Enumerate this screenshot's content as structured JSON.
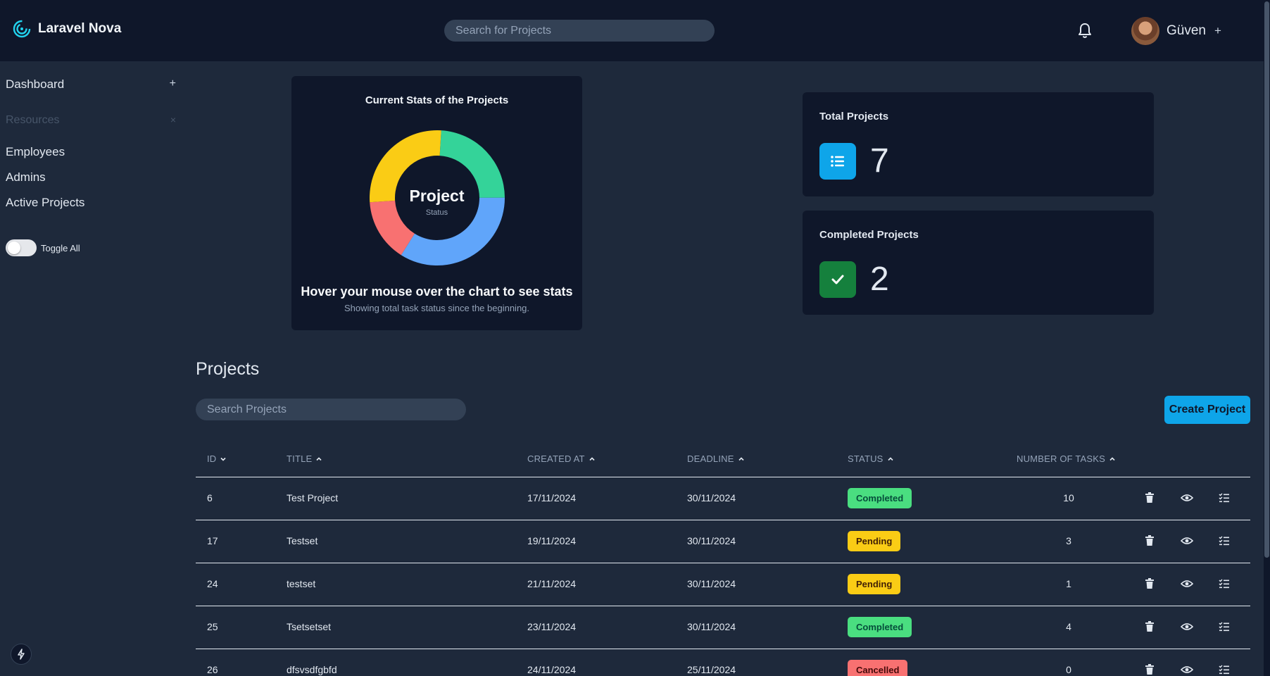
{
  "header": {
    "brand": "Laravel Nova",
    "search_placeholder": "Search for Projects",
    "user_name": "Güven",
    "user_plus": "+"
  },
  "sidebar": {
    "dashboard": "Dashboard",
    "dashboard_plus": "+",
    "resources": "Resources",
    "resources_close": "×",
    "items": [
      {
        "label": "Employees"
      },
      {
        "label": "Admins"
      },
      {
        "label": "Active Projects"
      }
    ],
    "toggle_label": "Toggle All"
  },
  "chart_card": {
    "title": "Current Stats of the Projects",
    "center_title": "Project",
    "center_sub": "Status",
    "hover_text": "Hover your mouse over the chart to see stats",
    "description": "Showing total task status since the beginning."
  },
  "chart_data": {
    "type": "pie",
    "title": "Current Stats of the Projects",
    "series": [
      {
        "value": 0.24,
        "color": "#34d399"
      },
      {
        "value": 0.34,
        "color": "#60a5fa"
      },
      {
        "value": 0.15,
        "color": "#f87171"
      },
      {
        "value": 0.27,
        "color": "#facc15"
      }
    ]
  },
  "metrics": {
    "total_label": "Total Projects",
    "total_value": "7",
    "completed_label": "Completed Projects",
    "completed_value": "2"
  },
  "projects": {
    "title": "Projects",
    "search_placeholder": "Search Projects",
    "create_label": "Create Project",
    "columns": [
      "ID",
      "TITLE",
      "CREATED AT",
      "DEADLINE",
      "STATUS",
      "NUMBER OF TASKS"
    ],
    "rows": [
      {
        "id": "6",
        "title": "Test Project",
        "created": "17/11/2024",
        "deadline": "30/11/2024",
        "status": "Completed",
        "tasks": "10"
      },
      {
        "id": "17",
        "title": "Testset",
        "created": "19/11/2024",
        "deadline": "30/11/2024",
        "status": "Pending",
        "tasks": "3"
      },
      {
        "id": "24",
        "title": "testset",
        "created": "21/11/2024",
        "deadline": "30/11/2024",
        "status": "Pending",
        "tasks": "1"
      },
      {
        "id": "25",
        "title": "Tsetsetset",
        "created": "23/11/2024",
        "deadline": "30/11/2024",
        "status": "Completed",
        "tasks": "4"
      },
      {
        "id": "26",
        "title": "dfsvsdfgbfd",
        "created": "24/11/2024",
        "deadline": "25/11/2024",
        "status": "Cancelled",
        "tasks": "0"
      }
    ]
  },
  "colors": {
    "completed_bg": "#4ade80",
    "pending_bg": "#facc15",
    "cancelled_bg": "#f87171",
    "accent": "#0ea5e9",
    "success": "#15803d"
  },
  "icons": {
    "logo": "nova-swirl-icon",
    "bell": "bell-icon",
    "delete": "trash-icon",
    "view": "eye-icon",
    "tasks": "checklist-icon",
    "total": "list-icon",
    "completed": "check-icon",
    "bolt": "bolt-icon"
  }
}
